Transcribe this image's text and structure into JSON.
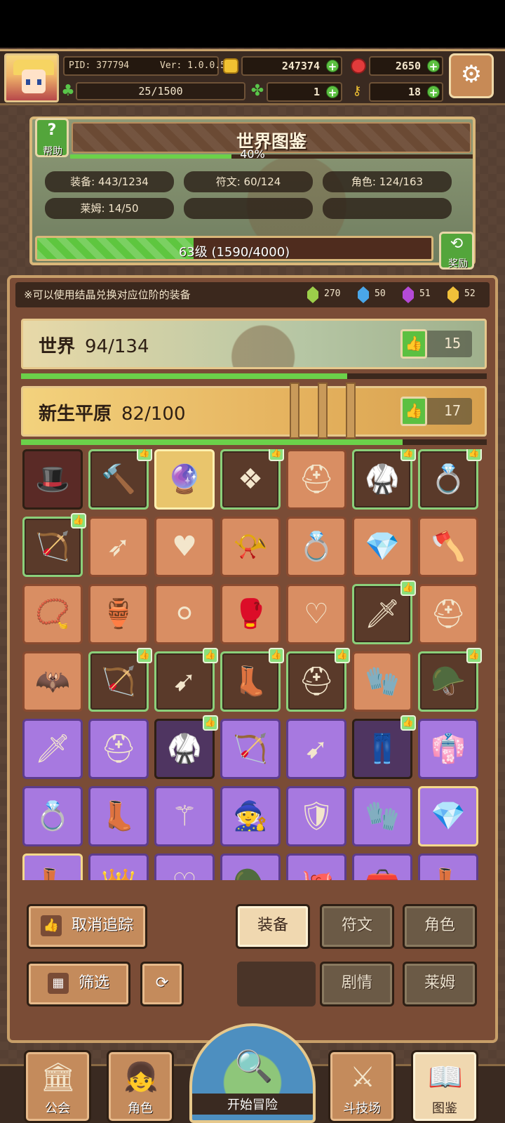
{
  "player": {
    "pid": "PID: 377794",
    "version": "Ver: 1.0.0.5",
    "gold": "247374",
    "gems": "2650",
    "stamina": "25/1500",
    "clover": "1",
    "keys": "18"
  },
  "collection": {
    "title": "世界图鉴",
    "help_label": "帮助",
    "progress_percent": "40%",
    "progress_fraction": 0.4,
    "stats": [
      "装备: 443/1234",
      "符文: 60/124",
      "角色: 124/163",
      "莱姆: 14/50"
    ],
    "level_text": "63级 (1590/4000)",
    "level_fraction": 0.3975,
    "reward_label": "奖励"
  },
  "notice": {
    "text": "※可以使用结晶兑换对应位阶的装备",
    "crystals": [
      {
        "color": "#9ccf4a",
        "count": "270"
      },
      {
        "color": "#4aa6e8",
        "count": "50"
      },
      {
        "color": "#b44ad6",
        "count": "51"
      },
      {
        "color": "#f0c03a",
        "count": "52"
      }
    ]
  },
  "regions": {
    "world": {
      "name": "世界",
      "count": "94/134",
      "tracked": "15",
      "progress": 0.7
    },
    "plain": {
      "name": "新生平原",
      "count": "82/100",
      "tracked": "17",
      "progress": 0.82
    }
  },
  "items": [
    {
      "style": "dark",
      "icon": "hat-icon",
      "glyph": "🎩",
      "marked": false
    },
    {
      "style": "green",
      "icon": "mace-icon",
      "glyph": "🔨",
      "marked": true
    },
    {
      "style": "gold",
      "icon": "orb-icon",
      "glyph": "🔮",
      "marked": false
    },
    {
      "style": "green",
      "icon": "scroll-icon",
      "glyph": "❖",
      "marked": true
    },
    {
      "style": "orange",
      "icon": "hood-icon",
      "glyph": "⛑",
      "marked": false
    },
    {
      "style": "green",
      "icon": "armor-icon",
      "glyph": "🥋",
      "marked": true
    },
    {
      "style": "green",
      "icon": "ring-icon",
      "glyph": "💍",
      "marked": true
    },
    {
      "style": "green",
      "icon": "crossbow-icon",
      "glyph": "🏹",
      "marked": true
    },
    {
      "style": "orange",
      "icon": "arrow-icon",
      "glyph": "➶",
      "marked": false
    },
    {
      "style": "orange",
      "icon": "necklace-icon",
      "glyph": "♥",
      "marked": false
    },
    {
      "style": "orange",
      "icon": "horn-icon",
      "glyph": "📯",
      "marked": false
    },
    {
      "style": "orange",
      "icon": "ring-icon",
      "glyph": "💍",
      "marked": false
    },
    {
      "style": "orange",
      "icon": "gem-ring-icon",
      "glyph": "💎",
      "marked": false
    },
    {
      "style": "orange",
      "icon": "axe-icon",
      "glyph": "🪓",
      "marked": false
    },
    {
      "style": "orange",
      "icon": "amulet-icon",
      "glyph": "📿",
      "marked": false
    },
    {
      "style": "orange",
      "icon": "pot-icon",
      "glyph": "🏺",
      "marked": false
    },
    {
      "style": "orange",
      "icon": "pearl-icon",
      "glyph": "⚪",
      "marked": false
    },
    {
      "style": "orange",
      "icon": "gauntlet-icon",
      "glyph": "🥊",
      "marked": false
    },
    {
      "style": "orange",
      "icon": "heart-necklace-icon",
      "glyph": "♡",
      "marked": false
    },
    {
      "style": "green",
      "icon": "sword-icon",
      "glyph": "🗡",
      "marked": true
    },
    {
      "style": "orange",
      "icon": "red-hood-icon",
      "glyph": "⛑",
      "marked": false
    },
    {
      "style": "orange",
      "icon": "cape-icon",
      "glyph": "🦇",
      "marked": false
    },
    {
      "style": "green",
      "icon": "bow-icon",
      "glyph": "🏹",
      "marked": true
    },
    {
      "style": "green",
      "icon": "spear-icon",
      "glyph": "➹",
      "marked": true
    },
    {
      "style": "green",
      "icon": "boots-icon",
      "glyph": "👢",
      "marked": true
    },
    {
      "style": "green",
      "icon": "hood-icon",
      "glyph": "⛑",
      "marked": true
    },
    {
      "style": "orange",
      "icon": "bracer-icon",
      "glyph": "🧤",
      "marked": false
    },
    {
      "style": "green",
      "icon": "helmet-icon",
      "glyph": "🪖",
      "marked": true
    },
    {
      "style": "purple",
      "icon": "sword-icon",
      "glyph": "🗡",
      "marked": false
    },
    {
      "style": "purple",
      "icon": "hood-icon",
      "glyph": "⛑",
      "marked": false
    },
    {
      "style": "purple-dark",
      "icon": "armor-icon",
      "glyph": "🥋",
      "marked": true
    },
    {
      "style": "purple",
      "icon": "crossbow-icon",
      "glyph": "🏹",
      "marked": false
    },
    {
      "style": "purple",
      "icon": "spear-icon",
      "glyph": "➹",
      "marked": false
    },
    {
      "style": "purple-dark",
      "icon": "pants-icon",
      "glyph": "👖",
      "marked": true
    },
    {
      "style": "purple",
      "icon": "robe-icon",
      "glyph": "👘",
      "marked": false
    },
    {
      "style": "purple",
      "icon": "ring-icon",
      "glyph": "💍",
      "marked": false
    },
    {
      "style": "purple",
      "icon": "boots-icon",
      "glyph": "👢",
      "marked": false
    },
    {
      "style": "purple",
      "icon": "scepter-icon",
      "glyph": "⚚",
      "marked": false
    },
    {
      "style": "purple",
      "icon": "wizard-hat-icon",
      "glyph": "🧙",
      "marked": false
    },
    {
      "style": "purple",
      "icon": "shoulder-armor-icon",
      "glyph": "🛡",
      "marked": false
    },
    {
      "style": "purple",
      "icon": "bracer-icon",
      "glyph": "🧤",
      "marked": false
    },
    {
      "style": "purple-gold",
      "icon": "gem-ring-icon",
      "glyph": "💎",
      "marked": false
    },
    {
      "style": "purple-gold",
      "icon": "boots-icon",
      "glyph": "👢",
      "marked": false
    },
    {
      "style": "purple",
      "icon": "crown-icon",
      "glyph": "👑",
      "marked": false
    },
    {
      "style": "purple",
      "icon": "necklace-icon",
      "glyph": "♡",
      "marked": false
    },
    {
      "style": "purple",
      "icon": "helmet-icon",
      "glyph": "🪖",
      "marked": false
    },
    {
      "style": "purple",
      "icon": "octopus-icon",
      "glyph": "🐙",
      "marked": false
    },
    {
      "style": "purple",
      "icon": "chest-icon",
      "glyph": "🧰",
      "marked": false
    },
    {
      "style": "purple",
      "icon": "boots-icon",
      "glyph": "👢",
      "marked": false
    }
  ],
  "controls": {
    "untrack": "取消追踪",
    "filter": "筛选",
    "tabs": [
      "装备",
      "符文",
      "角色",
      "剧情",
      "莱姆"
    ]
  },
  "nav": {
    "guild": "公会",
    "character": "角色",
    "adventure": "开始冒险",
    "arena": "斗技场",
    "codex": "图鉴"
  }
}
